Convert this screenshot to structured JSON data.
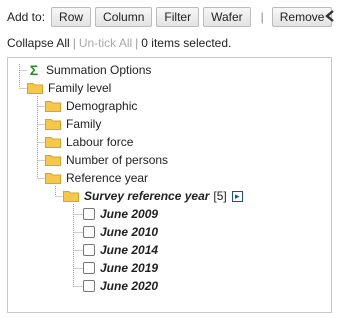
{
  "toolbar": {
    "add_to_label": "Add to:",
    "buttons": [
      "Row",
      "Column",
      "Filter",
      "Wafer"
    ],
    "separator": "|",
    "remove_label": "Remove",
    "collapse_panel_icon": "chevron-left-icon"
  },
  "linkbar": {
    "collapse_all": "Collapse All",
    "untick_all": "Un-tick All",
    "pipe": "|",
    "selection_status": "0 items selected."
  },
  "tree": {
    "summation": "Summation Options",
    "family_level": "Family level",
    "children": [
      "Demographic",
      "Family",
      "Labour force",
      "Number of persons",
      "Reference year"
    ],
    "survey_field": {
      "label": "Survey reference year",
      "count": "[5]",
      "expand_icon": "chevron-right-icon"
    },
    "years": [
      {
        "label": "June 2009",
        "checked": false
      },
      {
        "label": "June 2010",
        "checked": false
      },
      {
        "label": "June 2014",
        "checked": false
      },
      {
        "label": "June 2019",
        "checked": false
      },
      {
        "label": "June 2020",
        "checked": false
      }
    ]
  },
  "colors": {
    "folder": "#f5c84c",
    "folder_edge": "#d9a520",
    "sigma": "#2e8b2e",
    "expand_button": "#1a4fa0",
    "tree_line": "#a0a0a0"
  }
}
